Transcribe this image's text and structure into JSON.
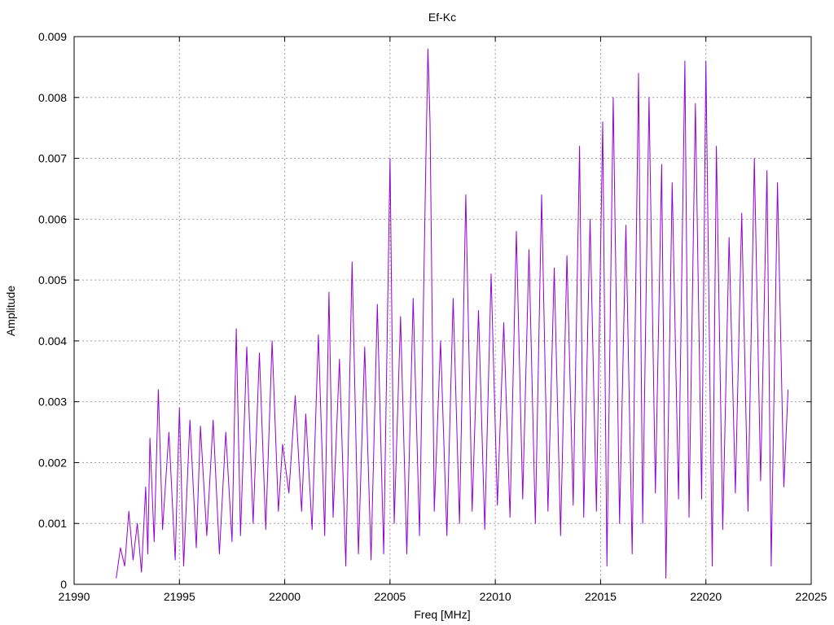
{
  "chart_data": {
    "type": "line",
    "title": "Ef-Kc",
    "xlabel": "Freq [MHz]",
    "ylabel": "Amplitude",
    "xlim": [
      21990,
      22025
    ],
    "ylim": [
      0,
      0.009
    ],
    "xticks": [
      21990,
      21995,
      22000,
      22005,
      22010,
      22015,
      22020,
      22025
    ],
    "xtick_labels": [
      "21990",
      "21995",
      "22000",
      "22005",
      "22010",
      "22015",
      "22020",
      "22025"
    ],
    "yticks": [
      0,
      0.001,
      0.002,
      0.003,
      0.004,
      0.005,
      0.006,
      0.007,
      0.008,
      0.009
    ],
    "ytick_labels": [
      "0",
      "0.001",
      "0.002",
      "0.003",
      "0.004",
      "0.005",
      "0.006",
      "0.007",
      "0.008",
      "0.009"
    ],
    "grid": true,
    "series": [
      {
        "color": "#9400d3",
        "x": [
          21992.0,
          21992.2,
          21992.4,
          21992.6,
          21992.8,
          21993.0,
          21993.2,
          21993.4,
          21993.5,
          21993.6,
          21993.8,
          21994.0,
          21994.2,
          21994.5,
          21994.8,
          21995.0,
          21995.2,
          21995.5,
          21995.8,
          21996.0,
          21996.3,
          21996.6,
          21996.9,
          21997.2,
          21997.5,
          21997.7,
          21997.9,
          21998.2,
          21998.5,
          21998.8,
          21999.1,
          21999.4,
          21999.7,
          21999.9,
          22000.2,
          22000.5,
          22000.8,
          22001.0,
          22001.3,
          22001.6,
          22001.9,
          22002.1,
          22002.3,
          22002.6,
          22002.9,
          22003.2,
          22003.5,
          22003.8,
          22004.1,
          22004.4,
          22004.7,
          22005.0,
          22005.2,
          22005.5,
          22005.8,
          22006.1,
          22006.4,
          22006.7,
          22006.8,
          22006.9,
          22007.1,
          22007.4,
          22007.7,
          22008.0,
          22008.3,
          22008.6,
          22008.9,
          22009.2,
          22009.5,
          22009.8,
          22010.1,
          22010.4,
          22010.7,
          22011.0,
          22011.3,
          22011.6,
          22011.9,
          22012.2,
          22012.5,
          22012.8,
          22013.1,
          22013.4,
          22013.7,
          22014.0,
          22014.2,
          22014.5,
          22014.8,
          22015.1,
          22015.3,
          22015.6,
          22015.9,
          22016.2,
          22016.5,
          22016.8,
          22017.0,
          22017.3,
          22017.6,
          22017.9,
          22018.1,
          22018.4,
          22018.7,
          22019.0,
          22019.2,
          22019.5,
          22019.8,
          22020.0,
          22020.3,
          22020.5,
          22020.8,
          22021.1,
          22021.4,
          22021.7,
          22022.0,
          22022.3,
          22022.6,
          22022.9,
          22023.1,
          22023.4,
          22023.7,
          22023.9
        ],
        "y": [
          0.0001,
          0.0006,
          0.0003,
          0.0012,
          0.0004,
          0.001,
          0.0002,
          0.0016,
          0.0005,
          0.0024,
          0.0007,
          0.0032,
          0.0009,
          0.0025,
          0.0004,
          0.0029,
          0.0003,
          0.0027,
          0.0006,
          0.0026,
          0.0008,
          0.0027,
          0.0005,
          0.0025,
          0.0007,
          0.0042,
          0.0008,
          0.0039,
          0.001,
          0.0038,
          0.0009,
          0.004,
          0.0012,
          0.0023,
          0.0015,
          0.0031,
          0.0012,
          0.0028,
          0.0009,
          0.0041,
          0.0008,
          0.0048,
          0.0011,
          0.0037,
          0.0003,
          0.0053,
          0.0005,
          0.0039,
          0.0004,
          0.0046,
          0.0005,
          0.007,
          0.001,
          0.0044,
          0.0005,
          0.0047,
          0.0008,
          0.0069,
          0.0088,
          0.0076,
          0.0012,
          0.004,
          0.0008,
          0.0047,
          0.001,
          0.0064,
          0.0012,
          0.0045,
          0.0009,
          0.0051,
          0.0013,
          0.0043,
          0.0011,
          0.0058,
          0.0014,
          0.0055,
          0.001,
          0.0064,
          0.0012,
          0.0052,
          0.0008,
          0.0054,
          0.0013,
          0.0072,
          0.0011,
          0.006,
          0.0012,
          0.0076,
          0.0003,
          0.008,
          0.001,
          0.0059,
          0.0005,
          0.0084,
          0.001,
          0.008,
          0.0015,
          0.0069,
          0.0001,
          0.0066,
          0.0014,
          0.0086,
          0.0011,
          0.0079,
          0.0014,
          0.0086,
          0.0003,
          0.0072,
          0.0009,
          0.0057,
          0.0015,
          0.0061,
          0.0012,
          0.007,
          0.0017,
          0.0068,
          0.0003,
          0.0066,
          0.0016,
          0.0032
        ]
      }
    ]
  }
}
